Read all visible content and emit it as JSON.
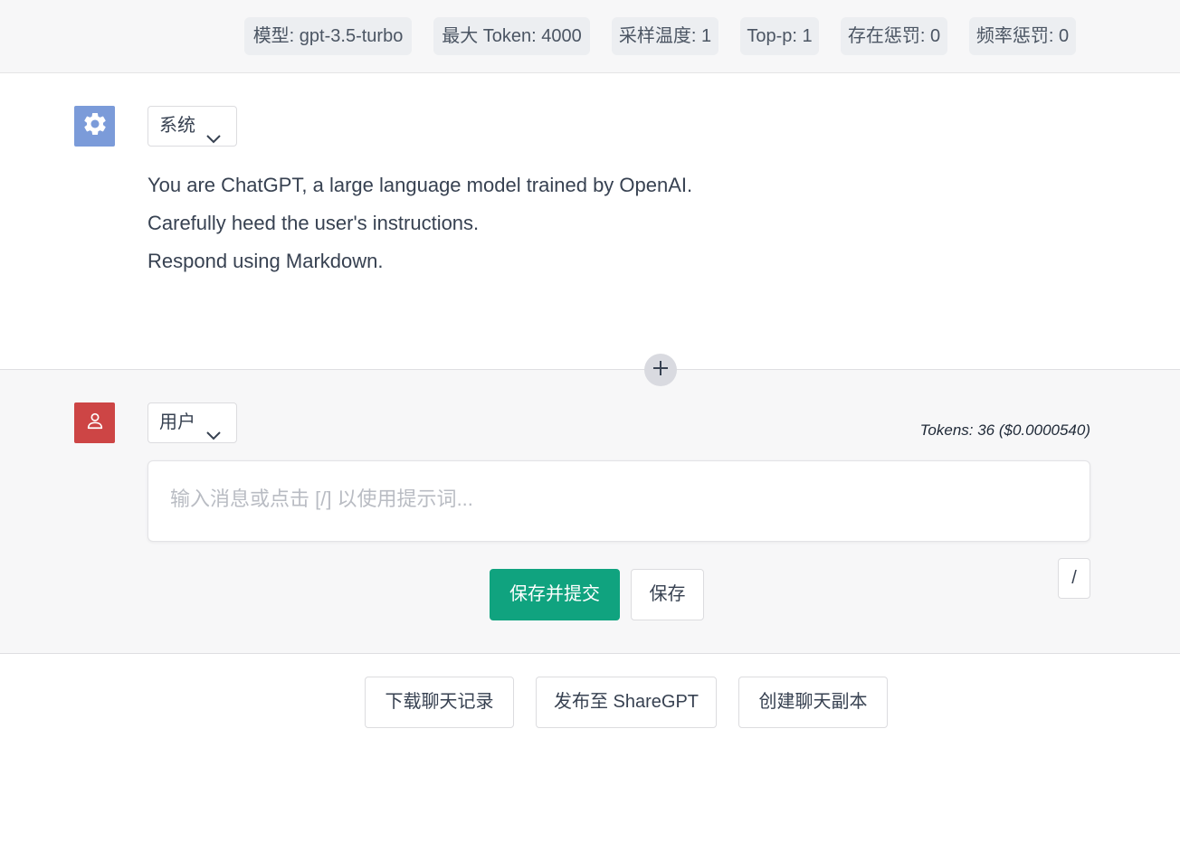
{
  "config": {
    "model": "模型: gpt-3.5-turbo",
    "max_token": "最大 Token: 4000",
    "temperature": "采样温度: 1",
    "top_p": "Top-p: 1",
    "presence_penalty": "存在惩罚: 0",
    "frequency_penalty": "频率惩罚: 0"
  },
  "system_message": {
    "role_label": "系统",
    "lines": [
      "You are ChatGPT, a large language model trained by OpenAI.",
      "Carefully heed the user's instructions.",
      "Respond using Markdown."
    ]
  },
  "user_message": {
    "role_label": "用户",
    "tokens": "Tokens: 36 ($0.0000540)",
    "input_placeholder": "输入消息或点击 [/] 以使用提示词...",
    "input_value": "",
    "submit_label": "保存并提交",
    "save_label": "保存",
    "prompt_shortcut_label": "/"
  },
  "footer_actions": {
    "download": "下载聊天记录",
    "share": "发布至 ShareGPT",
    "clone": "创建聊天副本"
  },
  "colors": {
    "primary": "#10a37f",
    "system_avatar": "#7b9bd9",
    "user_avatar": "#cd4545"
  }
}
